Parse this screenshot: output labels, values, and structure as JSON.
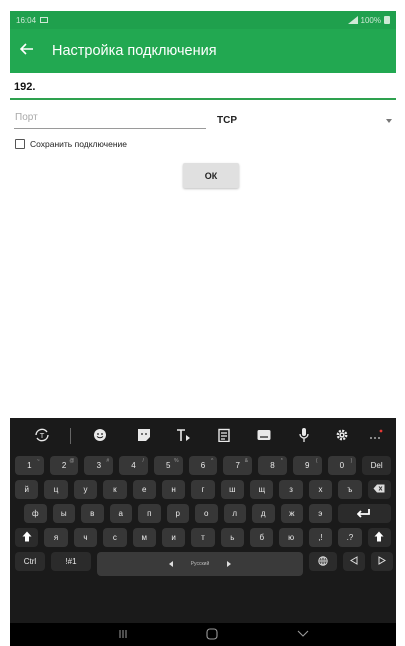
{
  "status_bar": {
    "time": "16:04",
    "battery": "100%"
  },
  "app_bar": {
    "back_icon": "arrow-left-icon",
    "title": "Настройка подключения"
  },
  "form": {
    "ip_value": "192.",
    "port_placeholder": "Порт",
    "protocol_selected": "TCP",
    "save_label": "Сохранить подключение",
    "ok_label": "ОК"
  },
  "keyboard": {
    "toolbar_icons": [
      "translate-icon",
      "emoji-icon",
      "sticker-icon",
      "text-style-icon",
      "clipboard-icon",
      "keyboard-icon",
      "microphone-icon",
      "settings-icon",
      "more-icon"
    ],
    "number_row": [
      {
        "key": "1",
        "sup": "~"
      },
      {
        "key": "2",
        "sup": "@"
      },
      {
        "key": "3",
        "sup": "#"
      },
      {
        "key": "4",
        "sup": "/"
      },
      {
        "key": "5",
        "sup": "%"
      },
      {
        "key": "6",
        "sup": "^"
      },
      {
        "key": "7",
        "sup": "&"
      },
      {
        "key": "8",
        "sup": "*"
      },
      {
        "key": "9",
        "sup": "("
      },
      {
        "key": "0",
        "sup": ")"
      }
    ],
    "del_label": "Del",
    "row1": [
      "й",
      "ц",
      "у",
      "к",
      "е",
      "н",
      "г",
      "ш",
      "щ",
      "з",
      "х",
      "ъ"
    ],
    "row2": [
      "ф",
      "ы",
      "в",
      "а",
      "п",
      "р",
      "о",
      "л",
      "д",
      "ж",
      "э"
    ],
    "row3": [
      "я",
      "ч",
      "с",
      "м",
      "и",
      "т",
      "ь",
      "б",
      "ю",
      ",!",
      ".?"
    ],
    "ctrl_label": "Ctrl",
    "sym_label": "!#1",
    "space_label": "Русский"
  },
  "colors": {
    "accent": "#22a851",
    "status_bar": "#1fa04d",
    "keyboard_bg": "#1a1a1a",
    "key_bg": "#373737"
  }
}
